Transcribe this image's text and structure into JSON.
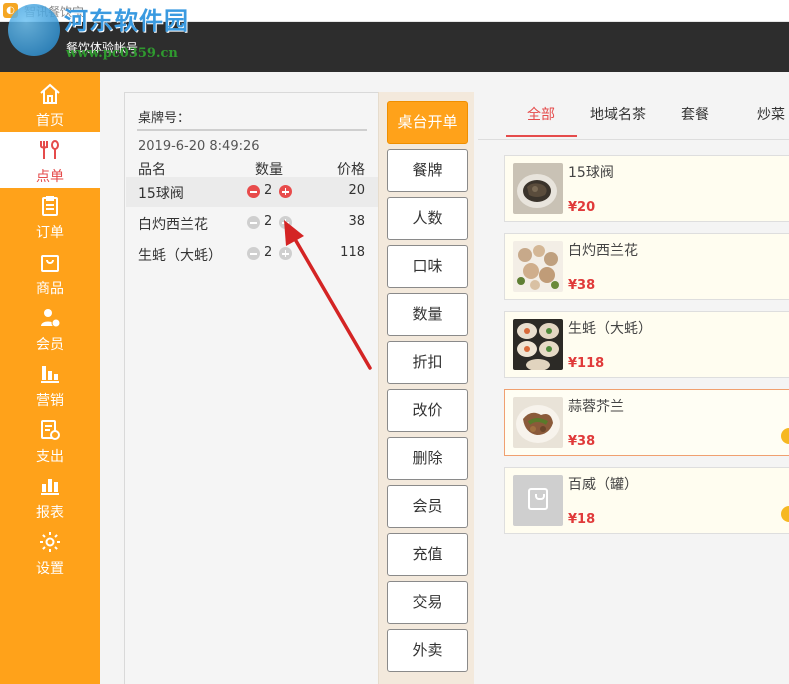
{
  "app": {
    "title": "智讯餐饮宝",
    "logo_glyph": "◐"
  },
  "header": {
    "account_name": "餐饮体验帐号"
  },
  "watermark": {
    "brand": "河东软件园",
    "url": "www.pc0359.cn"
  },
  "sidebar": {
    "accent_color": "#ffa21a",
    "active_color": "#e54b4b",
    "items": [
      {
        "label": "首页",
        "icon": "home-icon",
        "active": false
      },
      {
        "label": "点单",
        "icon": "fork-spoon-icon",
        "active": true
      },
      {
        "label": "订单",
        "icon": "clipboard-icon",
        "active": false
      },
      {
        "label": "商品",
        "icon": "bag-icon",
        "active": false
      },
      {
        "label": "会员",
        "icon": "member-icon",
        "active": false
      },
      {
        "label": "营销",
        "icon": "bar-chart-icon",
        "active": false
      },
      {
        "label": "支出",
        "icon": "expense-icon",
        "active": false
      },
      {
        "label": "报表",
        "icon": "report-icon",
        "active": false
      },
      {
        "label": "设置",
        "icon": "gear-icon",
        "active": false
      }
    ]
  },
  "order": {
    "table_label": "桌牌号：",
    "time": "2019-6-20 8:49:26",
    "columns": {
      "name": "品名",
      "qty": "数量",
      "price": "价格"
    },
    "items": [
      {
        "name": "15球阀",
        "qty": "2",
        "price": "20",
        "selected": true
      },
      {
        "name": "白灼西兰花",
        "qty": "2",
        "price": "38",
        "selected": false
      },
      {
        "name": "生蚝（大蚝）",
        "qty": "2",
        "price": "118",
        "selected": false
      }
    ]
  },
  "actions": [
    {
      "label": "桌台开单",
      "primary": true
    },
    {
      "label": "餐牌"
    },
    {
      "label": "人数"
    },
    {
      "label": "口味"
    },
    {
      "label": "数量"
    },
    {
      "label": "折扣"
    },
    {
      "label": "改价"
    },
    {
      "label": "删除"
    },
    {
      "label": "会员"
    },
    {
      "label": "充值"
    },
    {
      "label": "交易"
    },
    {
      "label": "外卖"
    }
  ],
  "menu": {
    "tabs": [
      {
        "label": "全部",
        "active": true
      },
      {
        "label": "地域名茶"
      },
      {
        "label": "套餐"
      },
      {
        "label": "炒菜"
      }
    ],
    "dishes": [
      {
        "name": "15球阀",
        "price": "¥20",
        "image": "dish-photo"
      },
      {
        "name": "白灼西兰花",
        "price": "¥38",
        "image": "dish-photo"
      },
      {
        "name": "生蚝（大蚝）",
        "price": "¥118",
        "image": "dish-photo"
      },
      {
        "name": "蒜蓉芥兰",
        "price": "¥38",
        "image": "dish-photo",
        "selected": true
      },
      {
        "name": "百威（罐）",
        "price": "¥18",
        "image": "placeholder-bag-icon"
      }
    ]
  }
}
